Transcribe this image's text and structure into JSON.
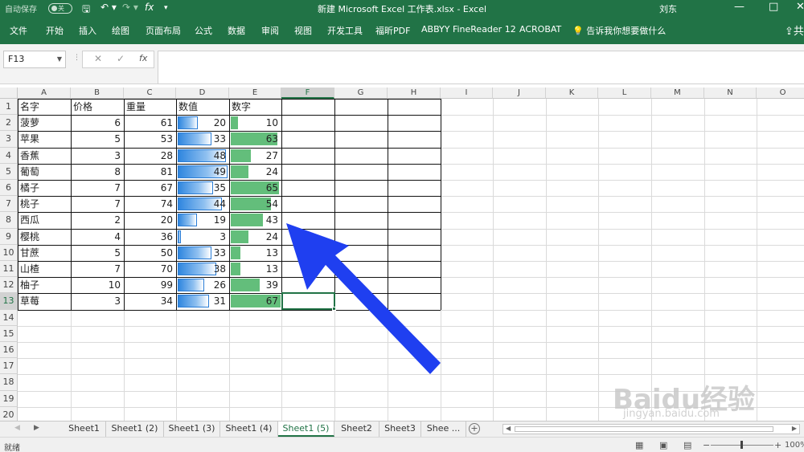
{
  "titlebar": {
    "autosave_label": "自动保存",
    "autosave_state": "关",
    "title": "新建 Microsoft Excel 工作表.xlsx  -  Excel",
    "user": "刘东",
    "qat": {
      "save": "🖫",
      "undo": "↶ ▾",
      "redo": "↷ ▾",
      "fx": "fx",
      "more": "▾"
    },
    "win": {
      "minimize": "—",
      "restore": "□",
      "close": "✕"
    }
  },
  "ribbon": {
    "tabs": [
      "文件",
      "开始",
      "插入",
      "绘图",
      "页面布局",
      "公式",
      "数据",
      "审阅",
      "视图",
      "开发工具",
      "福昕PDF",
      "ABBYY FineReader 12",
      "ACROBAT"
    ],
    "tell_me": "告诉我你想要做什么",
    "share": "共"
  },
  "formula_bar": {
    "name_box": "F13",
    "dots": "⋮",
    "cancel": "✕",
    "enter": "✓",
    "fx": "fx",
    "value": ""
  },
  "grid": {
    "columns": [
      "A",
      "B",
      "C",
      "D",
      "E",
      "F",
      "G",
      "H",
      "I",
      "J",
      "K",
      "L",
      "M",
      "N",
      "O"
    ],
    "rows": [
      "1",
      "2",
      "3",
      "4",
      "5",
      "6",
      "7",
      "8",
      "9",
      "10",
      "11",
      "12",
      "13",
      "14",
      "15",
      "16",
      "17",
      "18",
      "19",
      "20"
    ],
    "selected_column": "F",
    "selected_row": "13",
    "selected_cell": "F13",
    "headers": [
      "名字",
      "价格",
      "重量",
      "数值",
      "数字"
    ],
    "data": [
      {
        "name": "菠萝",
        "price": "6",
        "weight": "61",
        "value": "20",
        "number": "10",
        "vbar": 0.4,
        "nbar": 0.15
      },
      {
        "name": "苹果",
        "price": "5",
        "weight": "53",
        "value": "33",
        "number": "63",
        "vbar": 0.66,
        "nbar": 0.94
      },
      {
        "name": "香蕉",
        "price": "3",
        "weight": "28",
        "value": "48",
        "number": "27",
        "vbar": 0.96,
        "nbar": 0.4
      },
      {
        "name": "葡萄",
        "price": "8",
        "weight": "81",
        "value": "49",
        "number": "24",
        "vbar": 0.98,
        "nbar": 0.36
      },
      {
        "name": "橘子",
        "price": "7",
        "weight": "67",
        "value": "35",
        "number": "65",
        "vbar": 0.7,
        "nbar": 0.97
      },
      {
        "name": "桃子",
        "price": "7",
        "weight": "74",
        "value": "44",
        "number": "54",
        "vbar": 0.88,
        "nbar": 0.81
      },
      {
        "name": "西瓜",
        "price": "2",
        "weight": "20",
        "value": "19",
        "number": "43",
        "vbar": 0.38,
        "nbar": 0.64
      },
      {
        "name": "樱桃",
        "price": "4",
        "weight": "36",
        "value": "3",
        "number": "24",
        "vbar": 0.06,
        "nbar": 0.36
      },
      {
        "name": "甘蔗",
        "price": "5",
        "weight": "50",
        "value": "33",
        "number": "13",
        "vbar": 0.66,
        "nbar": 0.19
      },
      {
        "name": "山楂",
        "price": "7",
        "weight": "70",
        "value": "38",
        "number": "13",
        "vbar": 0.76,
        "nbar": 0.19
      },
      {
        "name": "柚子",
        "price": "10",
        "weight": "99",
        "value": "26",
        "number": "39",
        "vbar": 0.52,
        "nbar": 0.58
      },
      {
        "name": "草莓",
        "price": "3",
        "weight": "34",
        "value": "31",
        "number": "67",
        "vbar": 0.62,
        "nbar": 1.0
      }
    ]
  },
  "sheets": {
    "tabs": [
      "Sheet1",
      "Sheet1 (2)",
      "Sheet1 (3)",
      "Sheet1 (4)",
      "Sheet1 (5)",
      "Sheet2",
      "Sheet3",
      "Shee ..."
    ],
    "active": "Sheet1 (5)",
    "add": "+",
    "nav_prev": "◀",
    "nav_next": "▶"
  },
  "status": {
    "ready": "就绪",
    "zoom": "100%",
    "zoom_minus": "−",
    "zoom_plus": "+",
    "view_normal": "▦",
    "view_layout": "▣",
    "view_break": "▤"
  },
  "watermark": {
    "brand": "Baidu经验",
    "url": "jingyan.baidu.com"
  },
  "colors": {
    "excel_green": "#217346",
    "data_bar_blue": "#2f86df",
    "data_bar_green": "#63be7b",
    "annotation_arrow": "#1f3ff0"
  }
}
